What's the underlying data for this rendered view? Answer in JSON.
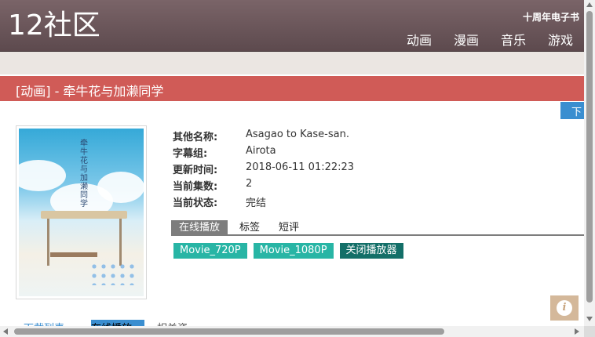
{
  "header": {
    "logo": "12社区",
    "anniversary_link": "十周年电子书",
    "nav": [
      "动画",
      "漫画",
      "音乐",
      "游戏"
    ]
  },
  "title_bar": {
    "text": "[动画] - 牵牛花与加濑同学"
  },
  "download_tab": {
    "label": "下"
  },
  "poster": {
    "title_vertical": "牵牛花与加濑同学"
  },
  "info": [
    {
      "key": "其他名称:",
      "value": "Asagao to Kase-san."
    },
    {
      "key": "字幕组:",
      "value": "Airota"
    },
    {
      "key": "更新时间:",
      "value": "2018-06-11 01:22:23"
    },
    {
      "key": "当前集数:",
      "value": "2"
    },
    {
      "key": "当前状态:",
      "value": "完结"
    }
  ],
  "tabs": [
    "在线播放",
    "标签",
    "短评"
  ],
  "buttons": [
    "Movie_720P",
    "Movie_1080P",
    "关闭播放器"
  ],
  "info_icon": "i",
  "bottom_cut": [
    "下载列表",
    "在线播放",
    "相关资源"
  ]
}
